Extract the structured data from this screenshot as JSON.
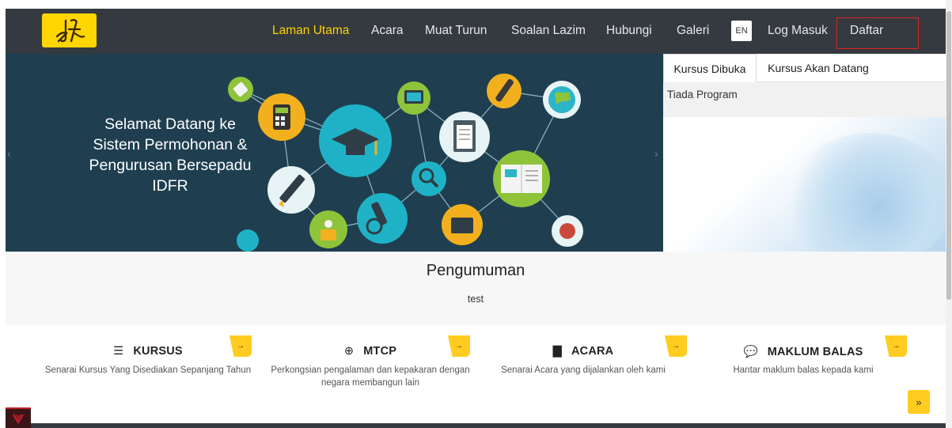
{
  "nav": {
    "items": [
      {
        "label": "Laman Utama",
        "active": true
      },
      {
        "label": "Acara"
      },
      {
        "label": "Muat Turun"
      },
      {
        "label": "Soalan Lazim"
      },
      {
        "label": "Hubungi"
      },
      {
        "label": "Galeri"
      }
    ],
    "lang": "EN",
    "login": "Log Masuk",
    "register": "Daftar"
  },
  "hero": {
    "lines": [
      "Selamat Datang ke",
      "Sistem Permohonan &",
      "Pengurusan Bersepadu",
      "IDFR"
    ]
  },
  "tabs": {
    "items": [
      {
        "label": "Kursus Dibuka",
        "active": true
      },
      {
        "label": "Kursus Akan Datang"
      }
    ],
    "empty_text": "Tiada Program"
  },
  "announcement": {
    "title": "Pengumuman",
    "body": "test"
  },
  "features": [
    {
      "icon": "list-icon",
      "title": "KURSUS",
      "desc": "Senarai Kursus Yang Disediakan Sepanjang Tahun"
    },
    {
      "icon": "globe-icon",
      "title": "MTCP",
      "desc": "Perkongsian pengalaman dan kepakaran dengan negara membangun lain"
    },
    {
      "icon": "calendar-icon",
      "title": "ACARA",
      "desc": "Senarai Acara yang dijalankan oleh kami"
    },
    {
      "icon": "comments-icon",
      "title": "MAKLUM BALAS",
      "desc": "Hantar maklum balas kepada kami"
    }
  ],
  "colors": {
    "navbar": "#343a40",
    "accent": "#ffd000",
    "feature_accent": "#ffcc1f",
    "hero_bg": "#1f3f50",
    "highlight_border": "#e02424"
  }
}
